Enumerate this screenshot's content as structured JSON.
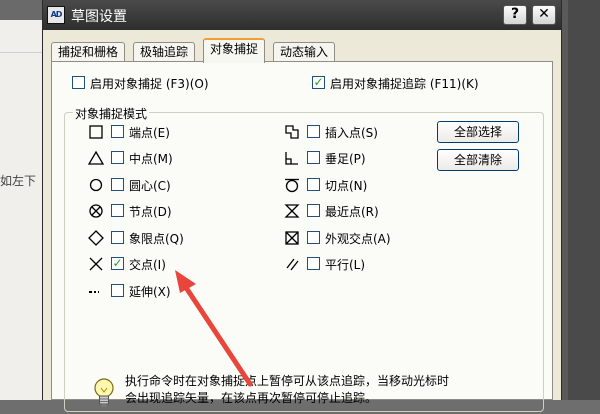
{
  "background": {
    "left_text": "如左下"
  },
  "window": {
    "title": "草图设置",
    "app_icon": "AD",
    "help_label": "?",
    "close_label": "✕"
  },
  "tabs": [
    {
      "label": "捕捉和栅格",
      "active": false
    },
    {
      "label": "极轴追踪",
      "active": false
    },
    {
      "label": "对象捕捉",
      "active": true
    },
    {
      "label": "动态输入",
      "active": false
    }
  ],
  "options": {
    "enable_osnap": {
      "label": "启用对象捕捉 (F3)(O)",
      "checked": false
    },
    "enable_tracking": {
      "label": "启用对象捕捉追踪 (F11)(K)",
      "checked": true
    }
  },
  "group_title": "对象捕捉模式",
  "snap_left": [
    {
      "label": "端点(E)",
      "icon": "endpoint-square-icon",
      "checked": false
    },
    {
      "label": "中点(M)",
      "icon": "midpoint-triangle-icon",
      "checked": false
    },
    {
      "label": "圆心(C)",
      "icon": "center-circle-icon",
      "checked": false
    },
    {
      "label": "节点(D)",
      "icon": "node-circle-x-icon",
      "checked": false
    },
    {
      "label": "象限点(Q)",
      "icon": "quadrant-diamond-icon",
      "checked": false
    },
    {
      "label": "交点(I)",
      "icon": "intersection-x-icon",
      "checked": true
    },
    {
      "label": "延伸(X)",
      "icon": "extension-dash-icon",
      "checked": false
    }
  ],
  "snap_right": [
    {
      "label": "插入点(S)",
      "icon": "insertion-squares-icon",
      "checked": false
    },
    {
      "label": "垂足(P)",
      "icon": "perpendicular-icon",
      "checked": false
    },
    {
      "label": "切点(N)",
      "icon": "tangent-circle-icon",
      "checked": false
    },
    {
      "label": "最近点(R)",
      "icon": "nearest-hourglass-icon",
      "checked": false
    },
    {
      "label": "外观交点(A)",
      "icon": "apparent-intersection-icon",
      "checked": false
    },
    {
      "label": "平行(L)",
      "icon": "parallel-lines-icon",
      "checked": false
    }
  ],
  "buttons": {
    "select_all": "全部选择",
    "clear_all": "全部清除"
  },
  "hint": {
    "icon": "lightbulb-icon",
    "line1": "执行命令时在对象捕捉点上暂停可从该点追踪，当移动光标时",
    "line2": "会出现追踪矢量，在该点再次暂停可停止追踪。"
  },
  "colors": {
    "accent": "#f0a030",
    "check": "#21a121",
    "arrow": "#e8453c"
  }
}
